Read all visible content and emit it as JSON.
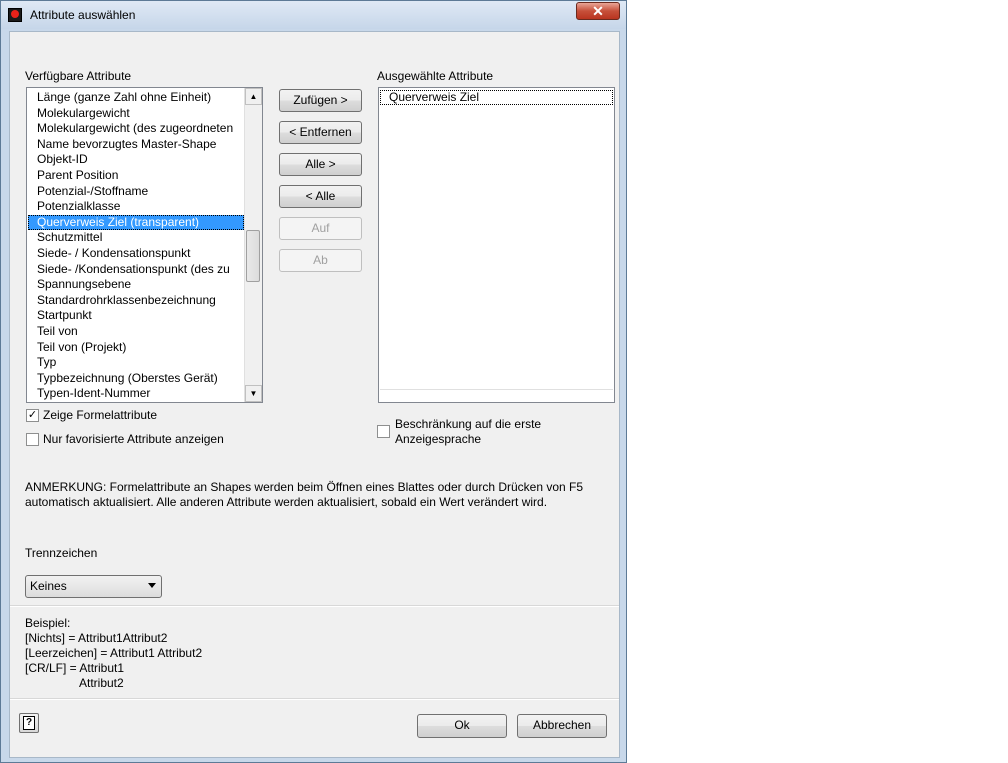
{
  "window": {
    "title": "Attribute auswählen",
    "close_glyph": "✕"
  },
  "available": {
    "label": "Verfügbare Attribute",
    "items": [
      "Länge (ganze Zahl ohne Einheit)",
      "Molekulargewicht",
      "Molekulargewicht (des zugeordneten",
      "Name bevorzugtes Master-Shape",
      "Objekt-ID",
      "Parent Position",
      "Potenzial-/Stoffname",
      "Potenzialklasse",
      "Querverweis Ziel (transparent)",
      "Schutzmittel",
      "Siede- / Kondensationspunkt",
      "Siede- /Kondensationspunkt (des zu",
      "Spannungsebene",
      "Standardrohrklassenbezeichnung",
      "Startpunkt",
      "Teil von",
      "Teil von (Projekt)",
      "Typ",
      "Typbezeichnung (Oberstes Gerät)",
      "Typen-Ident-Nummer"
    ],
    "selected_index": 8
  },
  "buttons": {
    "add": "Zufügen >",
    "remove": "< Entfernen",
    "add_all": "Alle >",
    "remove_all": "< Alle",
    "up": "Auf",
    "down": "Ab"
  },
  "selected": {
    "label": "Ausgewählte Attribute",
    "items": [
      "Querverweis Ziel"
    ]
  },
  "options": {
    "show_formula": {
      "label": "Zeige Formelattribute",
      "checked": true
    },
    "favorites_only": {
      "label": "Nur favorisierte Attribute anzeigen",
      "checked": false
    },
    "first_language_line1": "Beschränkung auf die erste",
    "first_language_line2": "Anzeigesprache"
  },
  "note": {
    "line1": "ANMERKUNG: Formelattribute an Shapes werden beim Öffnen eines Blattes oder durch Drücken von F5",
    "line2": "automatisch aktualisiert. Alle anderen Attribute werden aktualisiert, sobald ein Wert verändert wird."
  },
  "separator": {
    "label": "Trennzeichen",
    "value": "Keines"
  },
  "example": {
    "title": "Beispiel:",
    "l1": "[Nichts] = Attribut1Attribut2",
    "l2": "[Leerzeichen] = Attribut1 Attribut2",
    "l3": "[CR/LF] = Attribut1",
    "l4": "Attribut2"
  },
  "footer": {
    "ok": "Ok",
    "cancel": "Abbrechen",
    "help_icon": "help-icon"
  },
  "colors": {
    "selection": "#3399ff",
    "frame": "#c8d8ea",
    "close": "#c7503a"
  }
}
